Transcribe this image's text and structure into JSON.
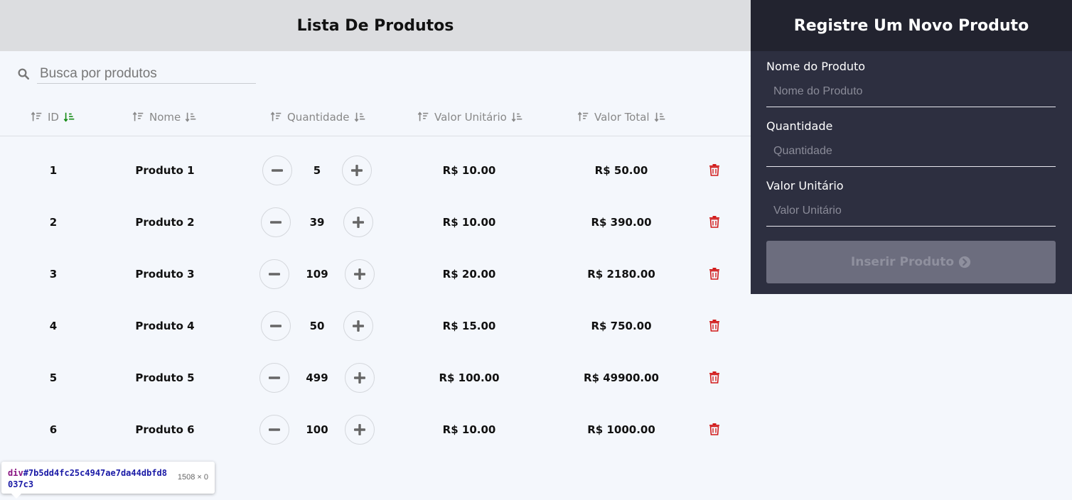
{
  "products_panel": {
    "title": "Lista De Produtos",
    "search": {
      "placeholder": "Busca por produtos",
      "value": ""
    },
    "columns": [
      {
        "label": "ID",
        "active_sort": true
      },
      {
        "label": "Nome",
        "active_sort": false
      },
      {
        "label": "Quantidade",
        "active_sort": false
      },
      {
        "label": "Valor Unitário",
        "active_sort": false
      },
      {
        "label": "Valor Total",
        "active_sort": false
      }
    ],
    "rows": [
      {
        "id": "1",
        "name": "Produto 1",
        "quantity": "5",
        "unit_value": "R$ 10.00",
        "total_value": "R$ 50.00"
      },
      {
        "id": "2",
        "name": "Produto 2",
        "quantity": "39",
        "unit_value": "R$ 10.00",
        "total_value": "R$ 390.00"
      },
      {
        "id": "3",
        "name": "Produto 3",
        "quantity": "109",
        "unit_value": "R$ 20.00",
        "total_value": "R$ 2180.00"
      },
      {
        "id": "4",
        "name": "Produto 4",
        "quantity": "50",
        "unit_value": "R$ 15.00",
        "total_value": "R$ 750.00"
      },
      {
        "id": "5",
        "name": "Produto 5",
        "quantity": "499",
        "unit_value": "R$ 100.00",
        "total_value": "R$ 49900.00"
      },
      {
        "id": "6",
        "name": "Produto 6",
        "quantity": "100",
        "unit_value": "R$ 10.00",
        "total_value": "R$ 1000.00"
      }
    ]
  },
  "register_panel": {
    "title": "Registre Um Novo Produto",
    "fields": [
      {
        "label": "Nome do Produto",
        "placeholder": "Nome do Produto",
        "value": ""
      },
      {
        "label": "Quantidade",
        "placeholder": "Quantidade",
        "value": ""
      },
      {
        "label": "Valor Unitário",
        "placeholder": "Valor Unitário",
        "value": ""
      }
    ],
    "submit_label": "Inserir Produto"
  },
  "devtools_tooltip": {
    "selector_tag": "div",
    "selector_id": "#7b5dd4fc25c4947ae7da44dbfd8037c3",
    "dimensions": "1508 × 0"
  },
  "colors": {
    "accent_sort_active": "#138a13",
    "delete_red": "#d11a1a",
    "dark_panel": "#2d2f40",
    "dark_header": "#22232f",
    "light_header": "#dcdde0"
  },
  "icons": {
    "search": "search-icon",
    "sort_asc": "sort-amount-up-icon",
    "sort_desc": "sort-amount-down-icon",
    "minus": "minus-icon",
    "plus": "plus-icon",
    "delete": "trash-icon",
    "submit_arrow": "chevron-circle-right-icon"
  }
}
